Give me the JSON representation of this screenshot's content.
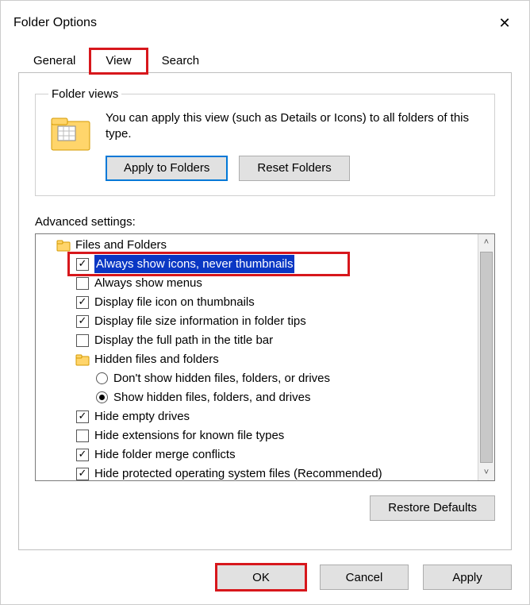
{
  "window": {
    "title": "Folder Options"
  },
  "tabs": {
    "general": "General",
    "view": "View",
    "search": "Search",
    "active": "view"
  },
  "folder_views": {
    "legend": "Folder views",
    "description": "You can apply this view (such as Details or Icons) to all folders of this type.",
    "apply_label": "Apply to Folders",
    "reset_label": "Reset Folders"
  },
  "advanced": {
    "label": "Advanced settings:",
    "items": [
      {
        "type": "group",
        "label": "Files and Folders"
      },
      {
        "type": "check",
        "checked": true,
        "selected": true,
        "label": "Always show icons, never thumbnails"
      },
      {
        "type": "check",
        "checked": false,
        "label": "Always show menus"
      },
      {
        "type": "check",
        "checked": true,
        "label": "Display file icon on thumbnails"
      },
      {
        "type": "check",
        "checked": true,
        "label": "Display file size information in folder tips"
      },
      {
        "type": "check",
        "checked": false,
        "label": "Display the full path in the title bar"
      },
      {
        "type": "group",
        "label": "Hidden files and folders",
        "indent": 2
      },
      {
        "type": "radio",
        "checked": false,
        "label": "Don't show hidden files, folders, or drives"
      },
      {
        "type": "radio",
        "checked": true,
        "label": "Show hidden files, folders, and drives"
      },
      {
        "type": "check",
        "checked": true,
        "label": "Hide empty drives"
      },
      {
        "type": "check",
        "checked": false,
        "label": "Hide extensions for known file types"
      },
      {
        "type": "check",
        "checked": true,
        "label": "Hide folder merge conflicts"
      },
      {
        "type": "check",
        "checked": true,
        "label": "Hide protected operating system files (Recommended)"
      }
    ],
    "restore_label": "Restore Defaults"
  },
  "footer": {
    "ok": "OK",
    "cancel": "Cancel",
    "apply": "Apply"
  }
}
